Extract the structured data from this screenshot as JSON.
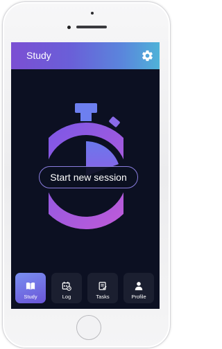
{
  "header": {
    "title": "Study"
  },
  "main": {
    "session_button": "Start new session"
  },
  "tabs": [
    {
      "label": "Study",
      "icon": "book-icon",
      "active": true
    },
    {
      "label": "Log",
      "icon": "calendar-icon",
      "active": false
    },
    {
      "label": "Tasks",
      "icon": "clipboard-icon",
      "active": false
    },
    {
      "label": "Profile",
      "icon": "person-icon",
      "active": false
    }
  ],
  "colors": {
    "accent_purple": "#7b4fd3",
    "accent_blue": "#4fb2d8",
    "screen_background": "#0c1022"
  }
}
